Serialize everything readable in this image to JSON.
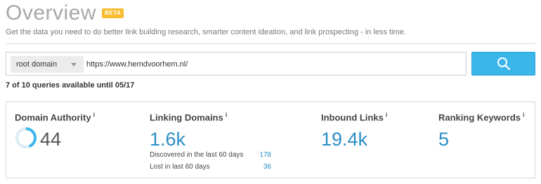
{
  "header": {
    "title": "Overview",
    "badge": "BETA",
    "subtitle": "Get the data you need to do better link building research, smarter content ideation, and link prospecting - in less time."
  },
  "search": {
    "scope_selected": "root domain",
    "url_value": "https://www.hemdvoorhem.nl/",
    "button_icon": "search-icon"
  },
  "quota": {
    "note": "7 of 10 queries available until 05/17"
  },
  "metrics": {
    "info_glyph": "i",
    "domain_authority": {
      "label": "Domain Authority",
      "value": "44",
      "ring_fraction": 0.44
    },
    "linking_domains": {
      "label": "Linking Domains",
      "value": "1.6k",
      "discovered_label": "Discovered in the last 60 days",
      "discovered_value": "178",
      "lost_label": "Lost in last 60 days",
      "lost_value": "36"
    },
    "inbound_links": {
      "label": "Inbound Links",
      "value": "19.4k"
    },
    "ranking_keywords": {
      "label": "Ranking Keywords",
      "value": "5"
    }
  },
  "colors": {
    "accent": "#3ab6eb",
    "value_blue": "#2b8fc6",
    "badge": "#f9bc30"
  }
}
